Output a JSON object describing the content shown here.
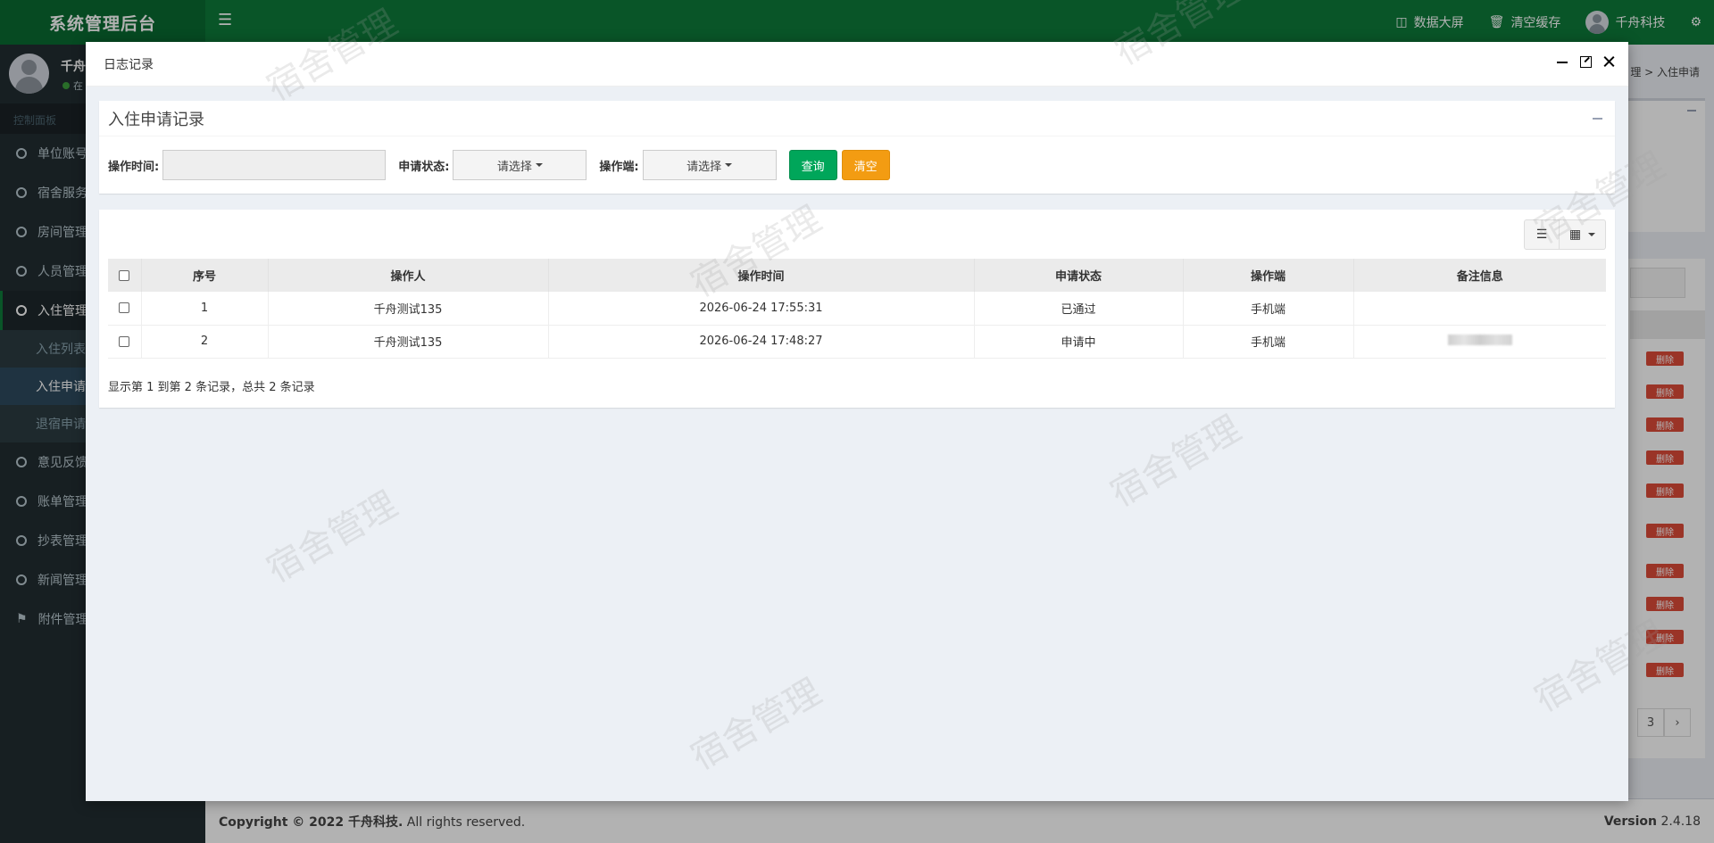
{
  "app": {
    "title": "系统管理后台",
    "top_items": [
      {
        "icon": "monitor-icon",
        "label": "数据大屏"
      },
      {
        "icon": "trash-icon",
        "label": "清空缓存"
      },
      {
        "icon": "avatar-icon",
        "label": "千舟科技"
      }
    ],
    "settings_icon": "gears-icon"
  },
  "sidebar": {
    "user_name": "千舟",
    "user_status": "在",
    "header": "控制面板",
    "items": [
      {
        "label": "单位账号",
        "icon": "circle-icon"
      },
      {
        "label": "宿舍服务",
        "icon": "circle-icon"
      },
      {
        "label": "房间管理",
        "icon": "circle-icon"
      },
      {
        "label": "人员管理",
        "icon": "circle-icon"
      },
      {
        "label": "入住管理",
        "icon": "circle-icon",
        "active": true
      },
      {
        "label": "意见反馈",
        "icon": "circle-icon"
      },
      {
        "label": "账单管理",
        "icon": "circle-icon"
      },
      {
        "label": "抄表管理",
        "icon": "circle-icon"
      },
      {
        "label": "新闻管理",
        "icon": "circle-icon"
      },
      {
        "label": "附件管理",
        "icon": "tags-icon"
      }
    ],
    "submenu": [
      {
        "label": "入住列表"
      },
      {
        "label": "入住申请",
        "active": true
      },
      {
        "label": "退宿申请"
      }
    ]
  },
  "background": {
    "breadcrumb": "理 > 入住申请",
    "delete_label": "删除",
    "page_current": "3",
    "page_next": "›"
  },
  "footer": {
    "copyright_prefix": "Copyright © 2022 ",
    "company": "千舟科技.",
    "rights": " All rights reserved.",
    "version_label": "Version",
    "version": "2.4.18"
  },
  "modal": {
    "title": "日志记录",
    "panel_title": "入住申请记录",
    "search": {
      "time_label": "操作时间:",
      "time_value": "",
      "status_label": "申请状态:",
      "status_value": "请选择",
      "client_label": "操作端:",
      "client_value": "请选择",
      "query_button": "查询",
      "clear_button": "清空"
    },
    "table": {
      "columns": [
        "序号",
        "操作人",
        "操作时间",
        "申请状态",
        "操作端",
        "备注信息"
      ],
      "rows": [
        {
          "no": "1",
          "operator": "千舟测试135",
          "time": "2026-06-24 17:55:31",
          "status": "已通过",
          "client": "手机端",
          "remark": ""
        },
        {
          "no": "2",
          "operator": "千舟测试135",
          "time": "2026-06-24 17:48:27",
          "status": "申请中",
          "client": "手机端",
          "remark": ""
        }
      ],
      "summary": "显示第 1 到第 2 条记录，总共 2 条记录"
    }
  },
  "watermark": "宿舍管理"
}
